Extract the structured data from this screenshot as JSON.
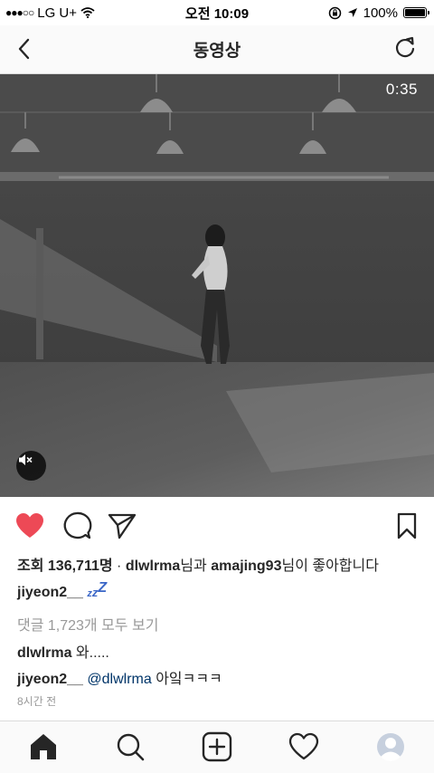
{
  "status_bar": {
    "signal": "●●●○○",
    "carrier": "LG U+",
    "time": "오전 10:09",
    "battery": "100%"
  },
  "nav": {
    "title": "동영상",
    "back_icon": "chevron-left-icon",
    "refresh_icon": "refresh-icon"
  },
  "video": {
    "timer": "0:35",
    "mute_icon": "speaker-muted-icon"
  },
  "actions": {
    "like_icon": "heart-filled-icon",
    "like_color": "#ed4956",
    "comment_icon": "comment-bubble-icon",
    "share_icon": "paper-plane-icon",
    "save_icon": "bookmark-icon"
  },
  "post": {
    "views_label": "조회",
    "views_count": "136,711명",
    "separator": "·",
    "liker1": "dlwlrma",
    "liker1_suffix": "님과",
    "liker2": "amajing93",
    "liker2_suffix": "님이 좋아합니다",
    "author": "jiyeon2__",
    "caption_emoji": "zzz",
    "view_all_comments": "댓글 1,723개 모두 보기",
    "comments": [
      {
        "user": "dlwlrma",
        "text": "와....."
      },
      {
        "user": "jiyeon2__",
        "mention": "@dlwlrma",
        "text": "아잌ㅋㅋㅋ"
      }
    ],
    "timestamp": "8시간 전"
  },
  "tab_bar": {
    "items": [
      "home-icon",
      "search-icon",
      "add-post-icon",
      "activity-heart-icon",
      "profile-avatar-icon"
    ]
  }
}
